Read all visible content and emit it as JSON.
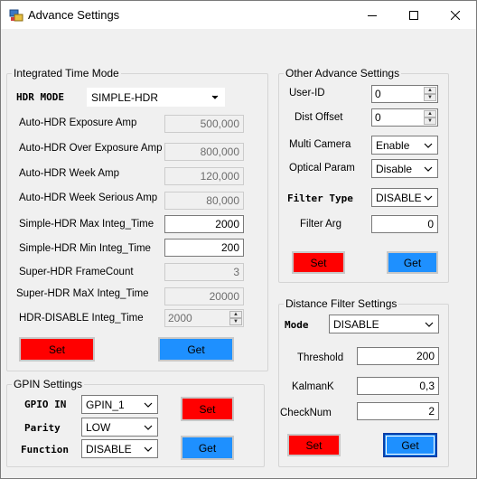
{
  "window": {
    "title": "Advance Settings",
    "controls": [
      "minimize",
      "maximize",
      "close"
    ]
  },
  "integrated_time_mode": {
    "title": "Integrated Time Mode",
    "hdr_mode_label": "HDR MODE",
    "hdr_mode_value": "SIMPLE-HDR",
    "fields": [
      {
        "label": "Auto-HDR Exposure Amp",
        "value": "500,000",
        "editable": false
      },
      {
        "label": "Auto-HDR Over Exposure Amp",
        "value": "800,000",
        "editable": false
      },
      {
        "label": "Auto-HDR Week Amp",
        "value": "120,000",
        "editable": false
      },
      {
        "label": "Auto-HDR Week  Serious Amp",
        "value": "80,000",
        "editable": false
      },
      {
        "label": "Simple-HDR Max Integ_Time",
        "value": "2000",
        "editable": true
      },
      {
        "label": "Simple-HDR Min Integ_Time",
        "value": "200",
        "editable": true
      },
      {
        "label": "Super-HDR FrameCount",
        "value": "3",
        "editable": false
      },
      {
        "label": "Super-HDR MaX Integ_Time",
        "value": "20000",
        "editable": false
      },
      {
        "label": "HDR-DISABLE Integ_Time",
        "value": "2000",
        "editable": false
      }
    ],
    "set_label": "Set",
    "get_label": "Get"
  },
  "gpin_settings": {
    "title": "GPIN Settings",
    "rows": [
      {
        "label": "GPIO IN",
        "value": "GPIN_1"
      },
      {
        "label": "Parity",
        "value": "LOW"
      },
      {
        "label": "Function",
        "value": "DISABLE"
      }
    ],
    "set_label": "Set",
    "get_label": "Get"
  },
  "other_advance": {
    "title": "Other Advance Settings",
    "user_id_label": "User-ID",
    "user_id_value": "0",
    "dist_offset_label": "Dist Offset",
    "dist_offset_value": "0",
    "multi_camera_label": "Multi Camera",
    "multi_camera_value": "Enable",
    "optical_param_label": "Optical Param",
    "optical_param_value": "Disable",
    "filter_type_label": "Filter Type",
    "filter_type_value": "DISABLE",
    "filter_arg_label": "Filter Arg",
    "filter_arg_value": "0",
    "set_label": "Set",
    "get_label": "Get"
  },
  "distance_filter": {
    "title": "Distance Filter Settings",
    "mode_label": "Mode",
    "mode_value": "DISABLE",
    "threshold_label": "Threshold",
    "threshold_value": "200",
    "kalman_label": "KalmanK",
    "kalman_value": "0,3",
    "checknum_label": "CheckNum",
    "checknum_value": "2",
    "set_label": "Set",
    "get_label": "Get"
  },
  "colors": {
    "set_button": "#ff0000",
    "get_button": "#1e90ff"
  }
}
